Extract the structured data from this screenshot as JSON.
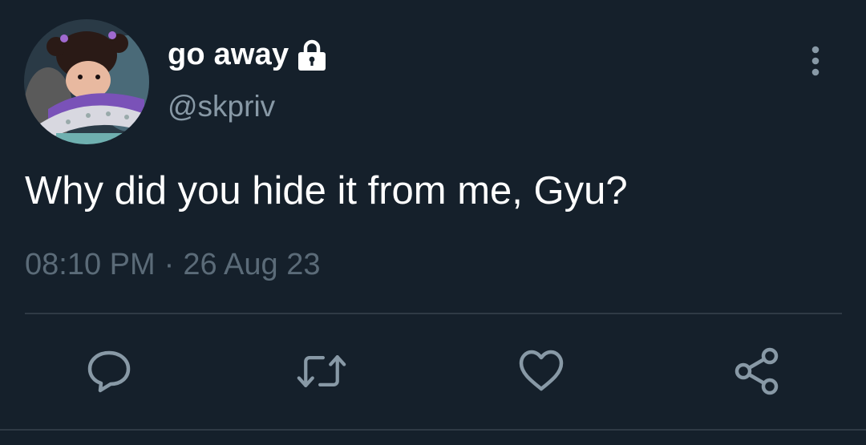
{
  "user": {
    "display_name": "go away",
    "handle": "@skpriv",
    "protected_icon": "lock-icon",
    "avatar": "animated-girl-avatar"
  },
  "tweet": {
    "text": "Why did you hide it from me, Gyu?",
    "time": "08:10 PM",
    "separator": "·",
    "date": "26 Aug 23"
  },
  "actions": {
    "reply_icon": "reply-icon",
    "retweet_icon": "retweet-icon",
    "like_icon": "heart-icon",
    "share_icon": "share-icon",
    "more_icon": "more-vertical-icon"
  },
  "colors": {
    "background": "#15202b",
    "primary_text": "#ffffff",
    "secondary_text": "#8899a6",
    "meta_text": "#5b6b78",
    "icon": "#8899a6",
    "divider": "#2f3a45"
  }
}
